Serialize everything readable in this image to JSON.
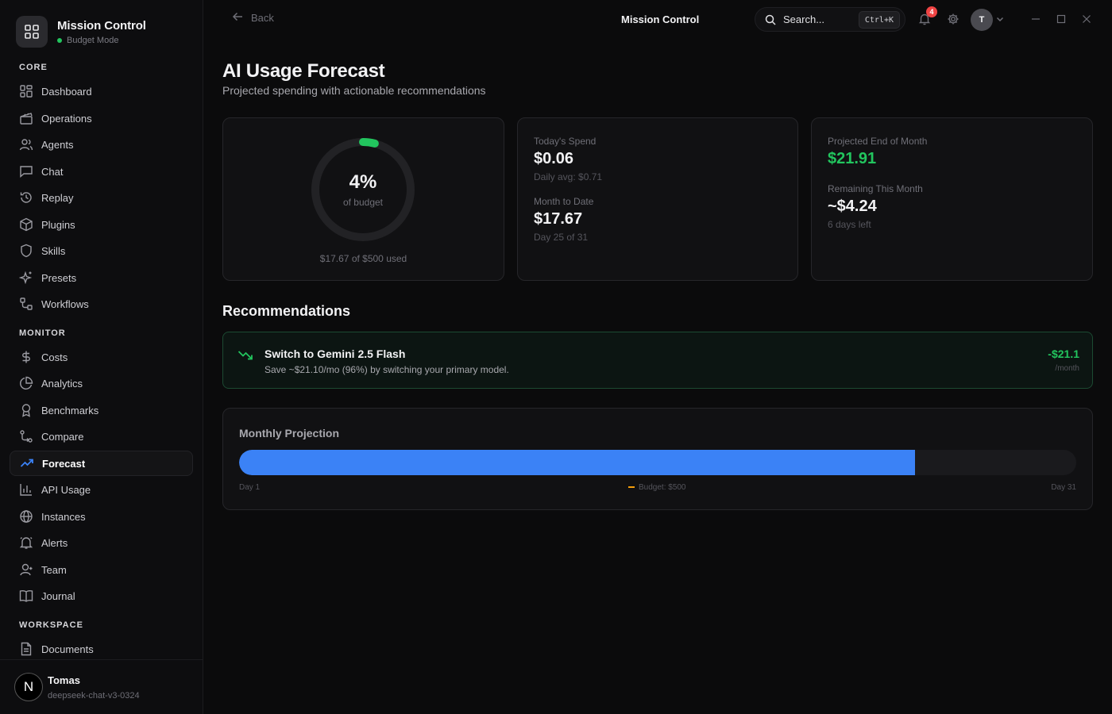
{
  "brand": {
    "title": "Mission Control",
    "mode": "Budget Mode"
  },
  "sidebar": {
    "sections": {
      "core": "CORE",
      "monitor": "MONITOR",
      "workspace": "WORKSPACE"
    },
    "core_items": [
      {
        "label": "Dashboard",
        "icon": "dashboard-icon"
      },
      {
        "label": "Operations",
        "icon": "clapper-icon"
      },
      {
        "label": "Agents",
        "icon": "users-icon"
      },
      {
        "label": "Chat",
        "icon": "chat-icon"
      },
      {
        "label": "Replay",
        "icon": "history-icon"
      },
      {
        "label": "Plugins",
        "icon": "package-icon"
      },
      {
        "label": "Skills",
        "icon": "shield-icon"
      },
      {
        "label": "Presets",
        "icon": "sparkles-icon"
      },
      {
        "label": "Workflows",
        "icon": "workflow-icon"
      }
    ],
    "monitor_items": [
      {
        "label": "Costs",
        "icon": "dollar-icon"
      },
      {
        "label": "Analytics",
        "icon": "pie-chart-icon"
      },
      {
        "label": "Benchmarks",
        "icon": "award-icon"
      },
      {
        "label": "Compare",
        "icon": "compare-icon"
      },
      {
        "label": "Forecast",
        "icon": "trending-up-icon",
        "active": true
      },
      {
        "label": "API Usage",
        "icon": "bar-chart-icon"
      },
      {
        "label": "Instances",
        "icon": "globe-icon"
      },
      {
        "label": "Alerts",
        "icon": "bell-icon"
      },
      {
        "label": "Team",
        "icon": "user-icon"
      },
      {
        "label": "Journal",
        "icon": "book-icon"
      }
    ],
    "workspace_items": [
      {
        "label": "Documents",
        "icon": "document-icon"
      }
    ],
    "user": {
      "initial": "N",
      "name": "Tomas",
      "model": "deepseek-chat-v3-0324"
    }
  },
  "topbar": {
    "back_label": "Back",
    "title": "Mission Control",
    "search_placeholder": "Search...",
    "search_shortcut": "Ctrl+K",
    "notification_count": "4",
    "avatar_initial": "T"
  },
  "page": {
    "title": "AI Usage Forecast",
    "subtitle": "Projected spending with actionable recommendations"
  },
  "budget_gauge": {
    "percent_label": "4%",
    "percent_value": 0.04,
    "caption": "of budget",
    "used_text": "$17.67 of $500 used"
  },
  "spend": {
    "today_label": "Today's Spend",
    "today_value": "$0.06",
    "daily_avg": "Daily avg: $0.71",
    "mtd_label": "Month to Date",
    "mtd_value": "$17.67",
    "day_progress": "Day 25 of 31"
  },
  "projection_stats": {
    "eom_label": "Projected End of Month",
    "eom_value": "$21.91",
    "remaining_label": "Remaining This Month",
    "remaining_value": "~$4.24",
    "days_left": "6 days left"
  },
  "recommendations": {
    "heading": "Recommendations",
    "items": [
      {
        "title": "Switch to Gemini 2.5 Flash",
        "description": "Save ~$21.10/mo (96%) by switching your primary model.",
        "amount": "-$21.1",
        "per": "/month"
      }
    ]
  },
  "monthly_projection": {
    "title": "Monthly Projection",
    "fill_fraction": 0.807,
    "start_label": "Day 1",
    "budget_label": "Budget: $500",
    "end_label": "Day 31"
  },
  "colors": {
    "accent_green": "#22c55e",
    "bar_blue": "#3b82f6",
    "alert_red": "#ef4444",
    "budget_amber": "#f59e0b"
  }
}
